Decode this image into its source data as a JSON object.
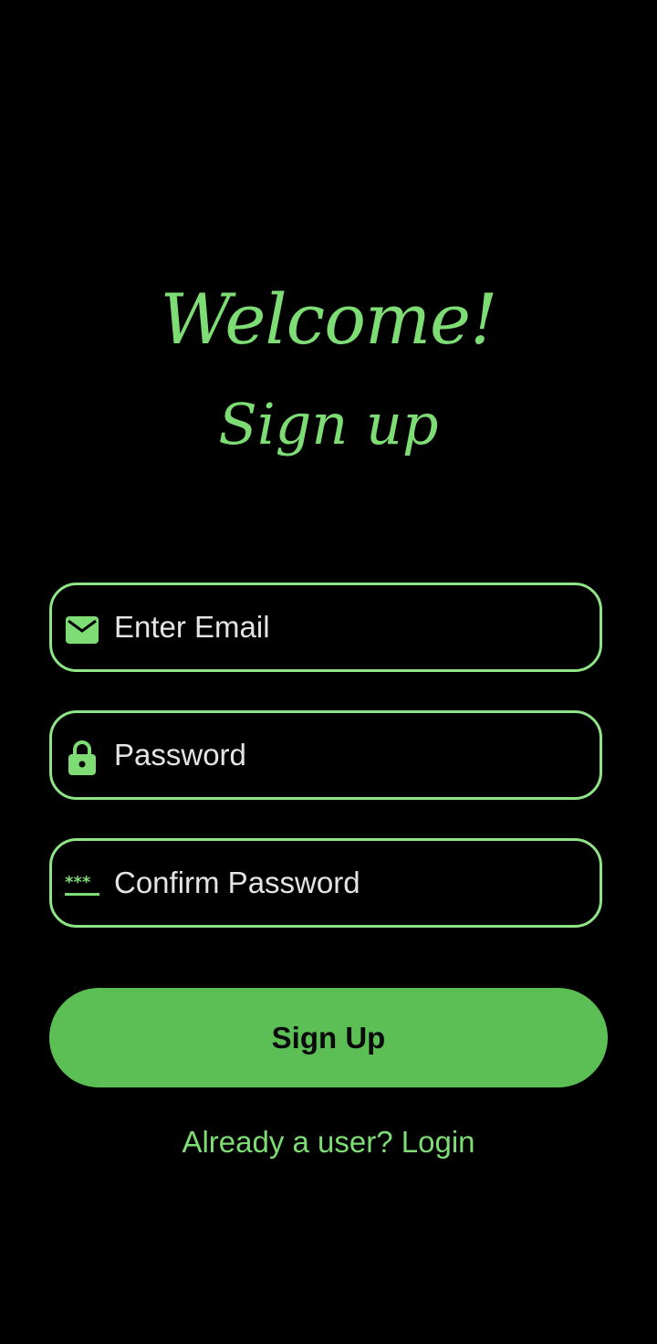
{
  "header": {
    "welcome": "Welcome!",
    "subtitle": "Sign up"
  },
  "form": {
    "email": {
      "placeholder": "Enter Email",
      "icon": "mail-icon"
    },
    "password": {
      "placeholder": "Password",
      "icon": "lock-icon"
    },
    "confirm_password": {
      "placeholder": "Confirm Password",
      "icon": "password-dots-icon"
    },
    "submit_label": "Sign Up"
  },
  "footer": {
    "login_link": "Already a user? Login"
  },
  "colors": {
    "background": "#000000",
    "accent": "#7ddc74",
    "field_border": "#8ee486",
    "button": "#5cbf55",
    "placeholder_text": "#e4e4e4"
  }
}
